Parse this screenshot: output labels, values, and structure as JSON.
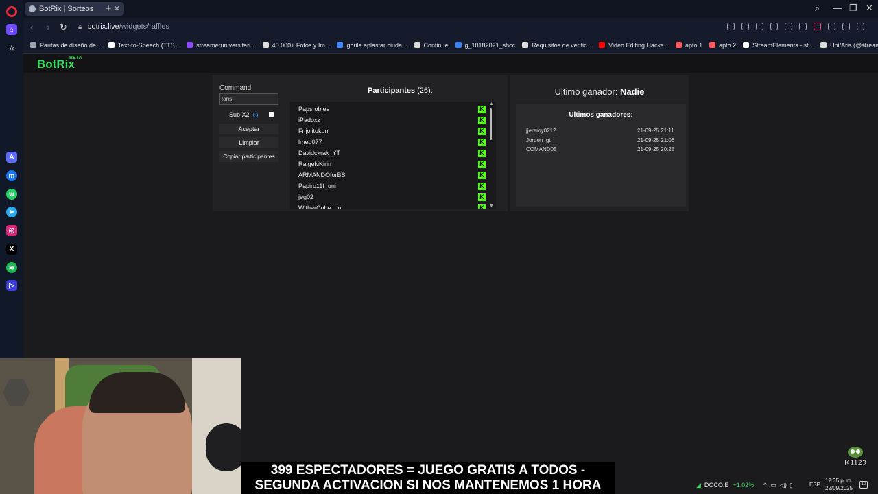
{
  "browser": {
    "tab_title": "BotRix | Sorteos",
    "url_host": "botrix.live",
    "url_path": "/widgets/raffles",
    "bookmarks": [
      {
        "label": "Pautas de diseño de...",
        "color": "#9aa3b5"
      },
      {
        "label": "Text-to-Speech (TTS...",
        "color": "#ffffff"
      },
      {
        "label": "streameruniversitari...",
        "color": "#9146ff"
      },
      {
        "label": "40.000+ Fotos y Im...",
        "color": "#dddddd"
      },
      {
        "label": "gorila aplastar ciuda...",
        "color": "#4285f4"
      },
      {
        "label": "Continue",
        "color": "#dddddd"
      },
      {
        "label": "g_10182021_shcc",
        "color": "#3b82f6"
      },
      {
        "label": "Requisitos de verific...",
        "color": "#dddddd"
      },
      {
        "label": "Video Editing Hacks...",
        "color": "#ff0000"
      },
      {
        "label": "apto 1",
        "color": "#ff5a5f"
      },
      {
        "label": "apto 2",
        "color": "#ff5a5f"
      },
      {
        "label": "StreamElements - st...",
        "color": "#ffffff"
      },
      {
        "label": "Uni/Aris (@streame...",
        "color": "#dddddd"
      }
    ]
  },
  "botrix": {
    "logo": "BotRix",
    "beta": "BETA"
  },
  "raffle": {
    "command_label": "Command:",
    "command_value": "!aris",
    "sub_label": "Sub X2",
    "accept_label": "Aceptar",
    "clear_label": "Limpiar",
    "copy_label": "Copiar participantes",
    "participants_title": "Participantes",
    "participants_count": "(26):",
    "participants": [
      "Papsrobles",
      "iPadoxz",
      "Frijolitokun",
      "lmeg077",
      "Davidckrak_YT",
      "RaigekiKirin",
      "ARMANDOforBS",
      "Papiro11f_uni",
      "jeg02",
      "WitherCube_uni"
    ]
  },
  "winners": {
    "last_label": "Ultimo ganador:",
    "last_name": "Nadie",
    "title": "Ultimos ganadores:",
    "list": [
      {
        "name": "jjeremy0212",
        "date": "21-09-25 21:11"
      },
      {
        "name": "Jorden_gt",
        "date": "21-09-25 21:06"
      },
      {
        "name": "COMAND05",
        "date": "21-09-25 20:25"
      }
    ]
  },
  "overlay": {
    "line1": "399 ESPECTADORES = JUEGO GRATIS A TODOS -",
    "line2": "SEGUNDA ACTIVACION SI NOS MANTENEMOS 1 HORA",
    "logo_text": "K1123"
  },
  "tray": {
    "ticker": "DOCO.E",
    "change": "+1.02%",
    "lang": "ESP",
    "time": "12:35 p. m.",
    "date": "22/09/2025",
    "notif_count": "10"
  }
}
